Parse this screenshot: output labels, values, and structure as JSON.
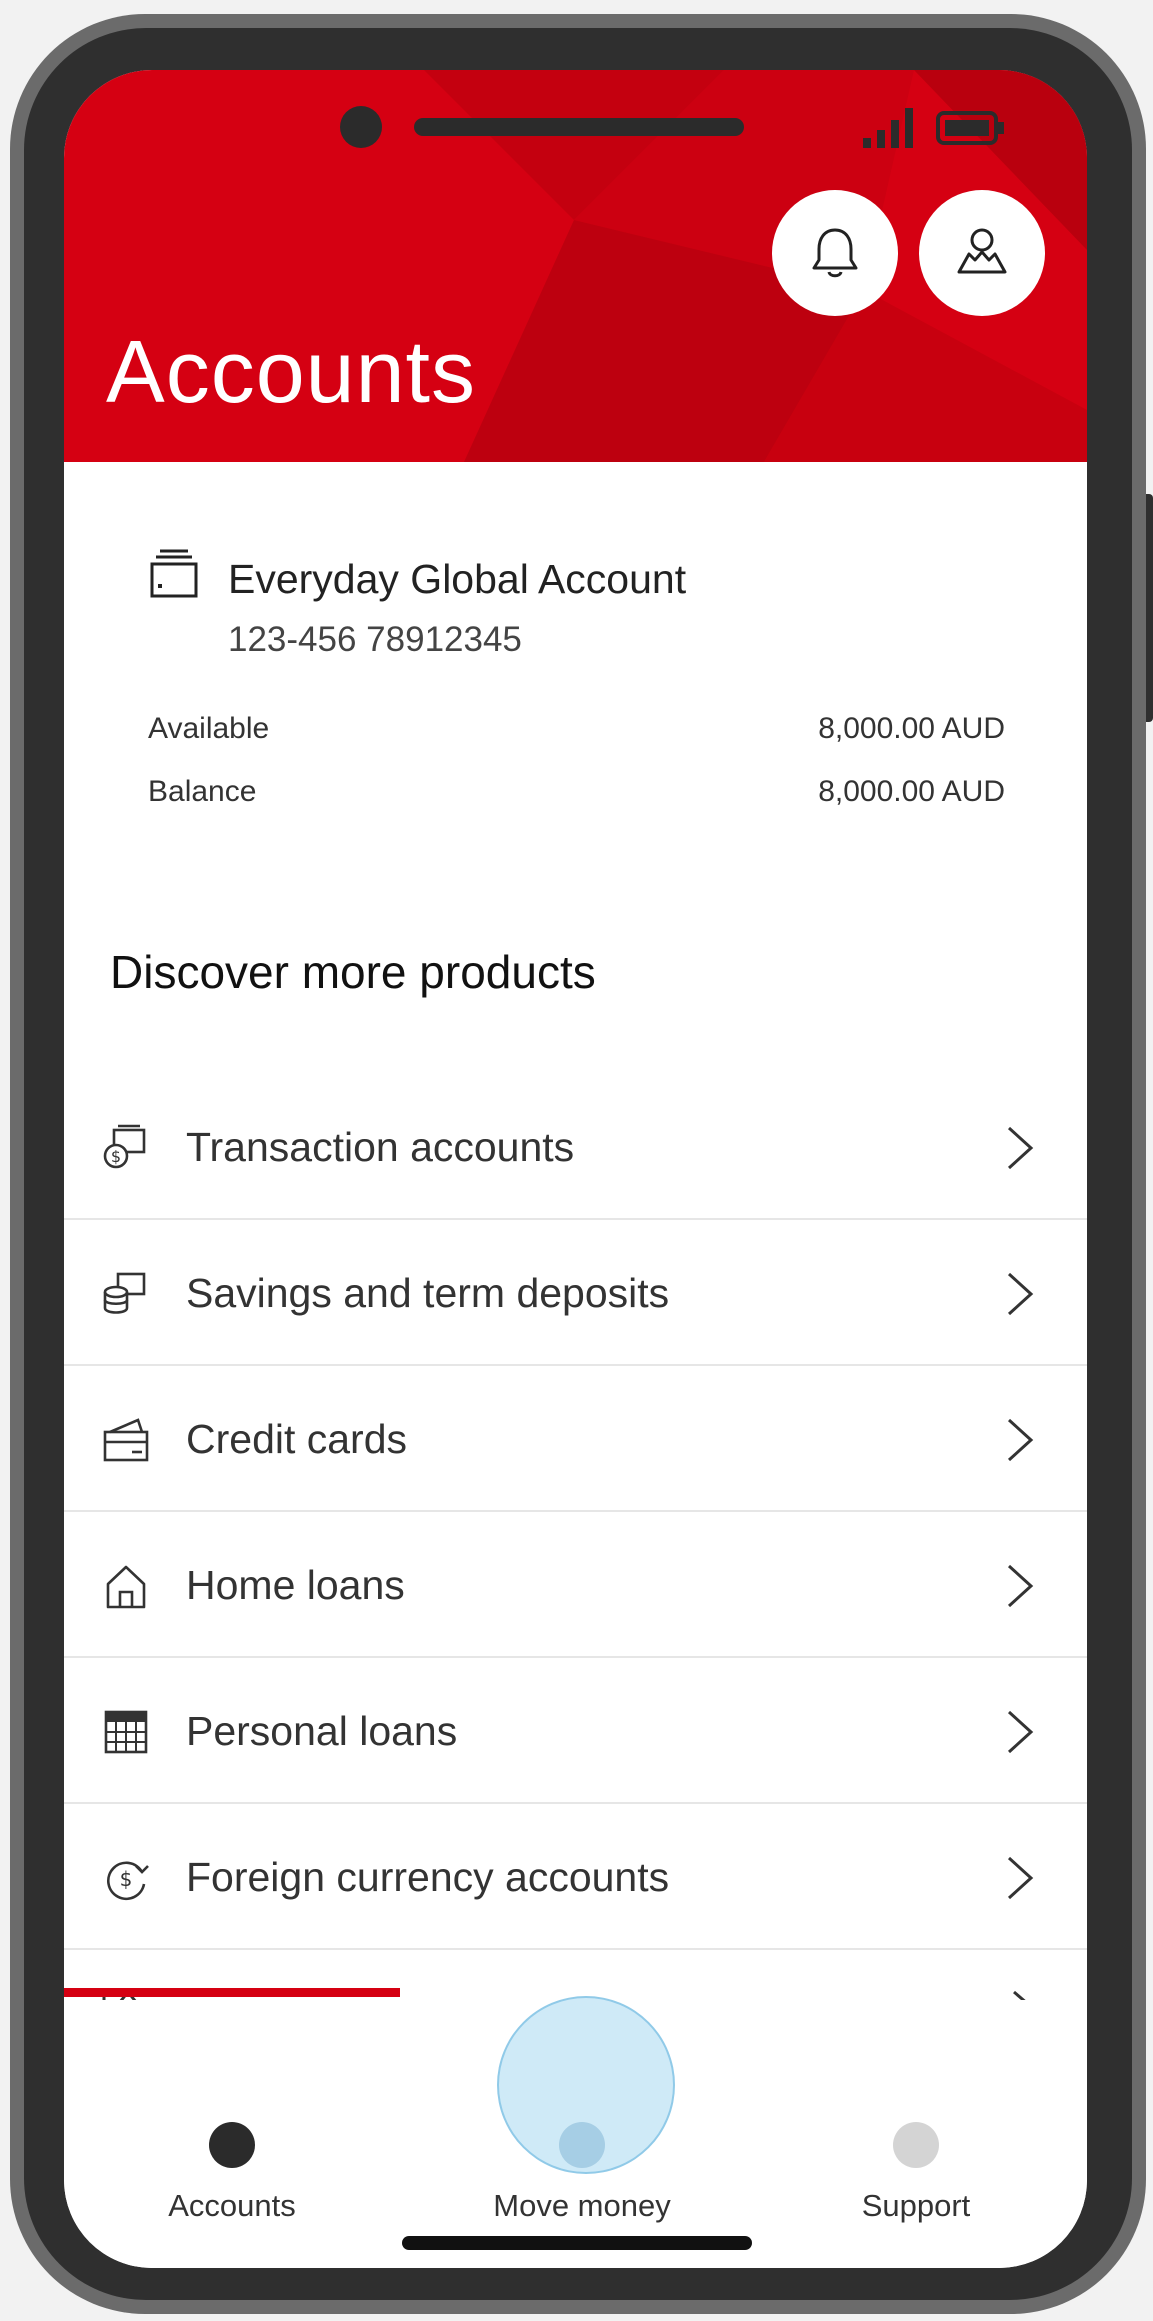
{
  "colors": {
    "brand_red": "#d50012",
    "nav_active": "#2b2b2b",
    "nav_inactive": "#d4d4d4",
    "nav_pressed": "#b8cfe0"
  },
  "header": {
    "title": "Accounts",
    "notifications_icon": "bell-icon",
    "profile_icon": "user-icon"
  },
  "account": {
    "icon": "wallet-icon",
    "name": "Everyday Global Account",
    "number": "123-456 78912345",
    "available_label": "Available",
    "available_value": "8,000.00 AUD",
    "balance_label": "Balance",
    "balance_value": "8,000.00 AUD"
  },
  "discover": {
    "heading": "Discover more products",
    "items": [
      {
        "label": "Transaction accounts",
        "icon": "transaction-account-icon"
      },
      {
        "label": "Savings and term deposits",
        "icon": "savings-icon"
      },
      {
        "label": "Credit cards",
        "icon": "credit-card-icon"
      },
      {
        "label": "Home loans",
        "icon": "home-icon"
      },
      {
        "label": "Personal loans",
        "icon": "calculator-icon"
      },
      {
        "label": "Foreign currency accounts",
        "icon": "currency-exchange-icon"
      }
    ]
  },
  "bottom_nav": {
    "items": [
      {
        "label": "Accounts",
        "state": "active"
      },
      {
        "label": "Move money",
        "state": "pressed"
      },
      {
        "label": "Support",
        "state": "inactive"
      }
    ]
  }
}
